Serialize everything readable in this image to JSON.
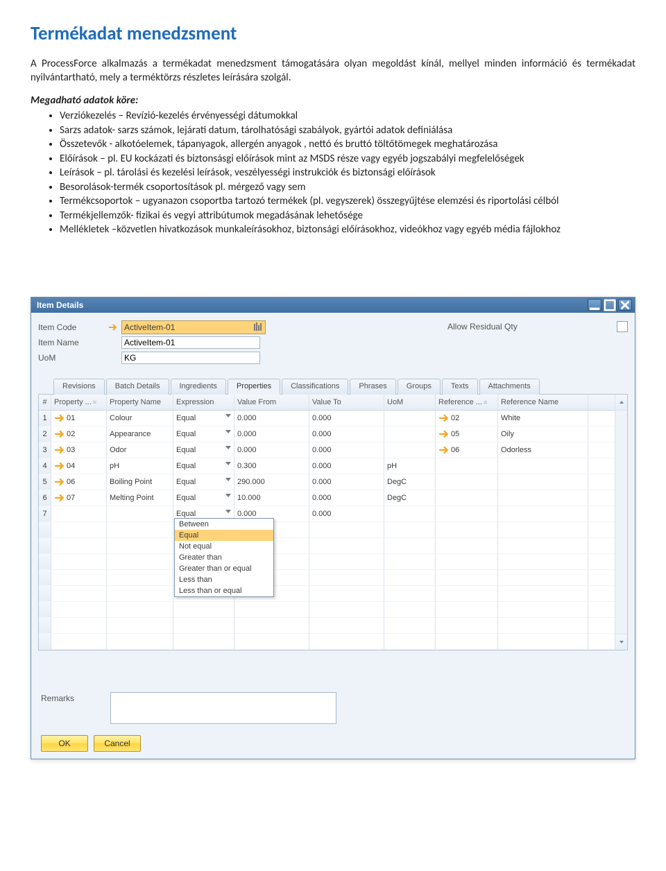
{
  "doc": {
    "title": "Termékadat menedzsment",
    "intro": "A ProcessForce alkalmazás a termékadat menedzsment támogatására olyan megoldást kínál, mellyel minden információ és termékadat nyilvántartható, mely a terméktörzs részletes leírására szolgál.",
    "section_label": "Megadható adatok köre:",
    "bullets": [
      "Verziókezelés – Revízió-kezelés érvényességi dátumokkal",
      "Sarzs adatok- sarzs számok, lejárati datum, tárolhatósági szabályok, gyártói adatok definiálása",
      "Összetevők - alkotóelemek, tápanyagok, allergén anyagok , nettó és bruttó töltőtömegek meghatározása",
      "Előírások – pl. EU kockázati és biztonsásgi előírások mint az MSDS része vagy egyéb jogszabályi megfelelőségek",
      "Leírások – pl. tárolási és kezelési leírások, veszélyességi instrukciók és biztonsági előírások",
      "Besorolások-termék csoportosítások pl. mérgező vagy sem",
      "Termékcsoportok – ugyanazon csoportba tartozó termékek (pl. vegyszerek) összegyűjtése elemzési és riportolási célból",
      "Termékjellemzők- fizikai és vegyi attribútumok megadásának lehetősége",
      "Mellékletek –közvetlen hivatkozások munkaleírásokhoz, biztonsági előírásokhoz, videókhoz vagy egyéb média fájlokhoz"
    ]
  },
  "win": {
    "title": "Item Details",
    "form": {
      "item_code_label": "Item Code",
      "item_code_value": "ActiveItem-01",
      "item_name_label": "Item Name",
      "item_name_value": "ActiveItem-01",
      "uom_label": "UoM",
      "uom_value": "KG",
      "allow_residual_label": "Allow Residual Qty"
    },
    "tabs": [
      "Revisions",
      "Batch Details",
      "Ingredients",
      "Properties",
      "Classifications",
      "Phrases",
      "Groups",
      "Texts",
      "Attachments"
    ],
    "active_tab": "Properties",
    "grid": {
      "headers": {
        "num": "#",
        "prop_code": "Property ...",
        "prop_name": "Property Name",
        "expr": "Expression",
        "val_from": "Value From",
        "val_to": "Value To",
        "uom": "UoM",
        "ref": "Reference ...",
        "ref_name": "Reference Name"
      },
      "rows": [
        {
          "num": "1",
          "prop_code": "01",
          "prop_name": "Colour",
          "expr": "Equal",
          "val_from": "0.000",
          "val_to": "0.000",
          "uom": "",
          "ref": "02",
          "ref_name": "White"
        },
        {
          "num": "2",
          "prop_code": "02",
          "prop_name": "Appearance",
          "expr": "Equal",
          "val_from": "0.000",
          "val_to": "0.000",
          "uom": "",
          "ref": "05",
          "ref_name": "Oily"
        },
        {
          "num": "3",
          "prop_code": "03",
          "prop_name": "Odor",
          "expr": "Equal",
          "val_from": "0.000",
          "val_to": "0.000",
          "uom": "",
          "ref": "06",
          "ref_name": "Odorless"
        },
        {
          "num": "4",
          "prop_code": "04",
          "prop_name": "pH",
          "expr": "Equal",
          "val_from": "0.300",
          "val_to": "0.000",
          "uom": "pH",
          "ref": "",
          "ref_name": ""
        },
        {
          "num": "5",
          "prop_code": "06",
          "prop_name": "Boiling Point",
          "expr": "Equal",
          "val_from": "290.000",
          "val_to": "0.000",
          "uom": "DegC",
          "ref": "",
          "ref_name": ""
        },
        {
          "num": "6",
          "prop_code": "07",
          "prop_name": "Melting Point",
          "expr": "Equal",
          "val_from": "10.000",
          "val_to": "0.000",
          "uom": "DegC",
          "ref": "",
          "ref_name": ""
        },
        {
          "num": "7",
          "prop_code": "",
          "prop_name": "",
          "expr": "Equal",
          "val_from": "0.000",
          "val_to": "0.000",
          "uom": "",
          "ref": "",
          "ref_name": ""
        }
      ],
      "dropdown_options": [
        "Between",
        "Equal",
        "Not equal",
        "Greater than",
        "Greater than or equal",
        "Less than",
        "Less than or equal"
      ],
      "dropdown_selected": "Equal"
    },
    "remarks_label": "Remarks",
    "buttons": {
      "ok": "OK",
      "cancel": "Cancel"
    }
  }
}
